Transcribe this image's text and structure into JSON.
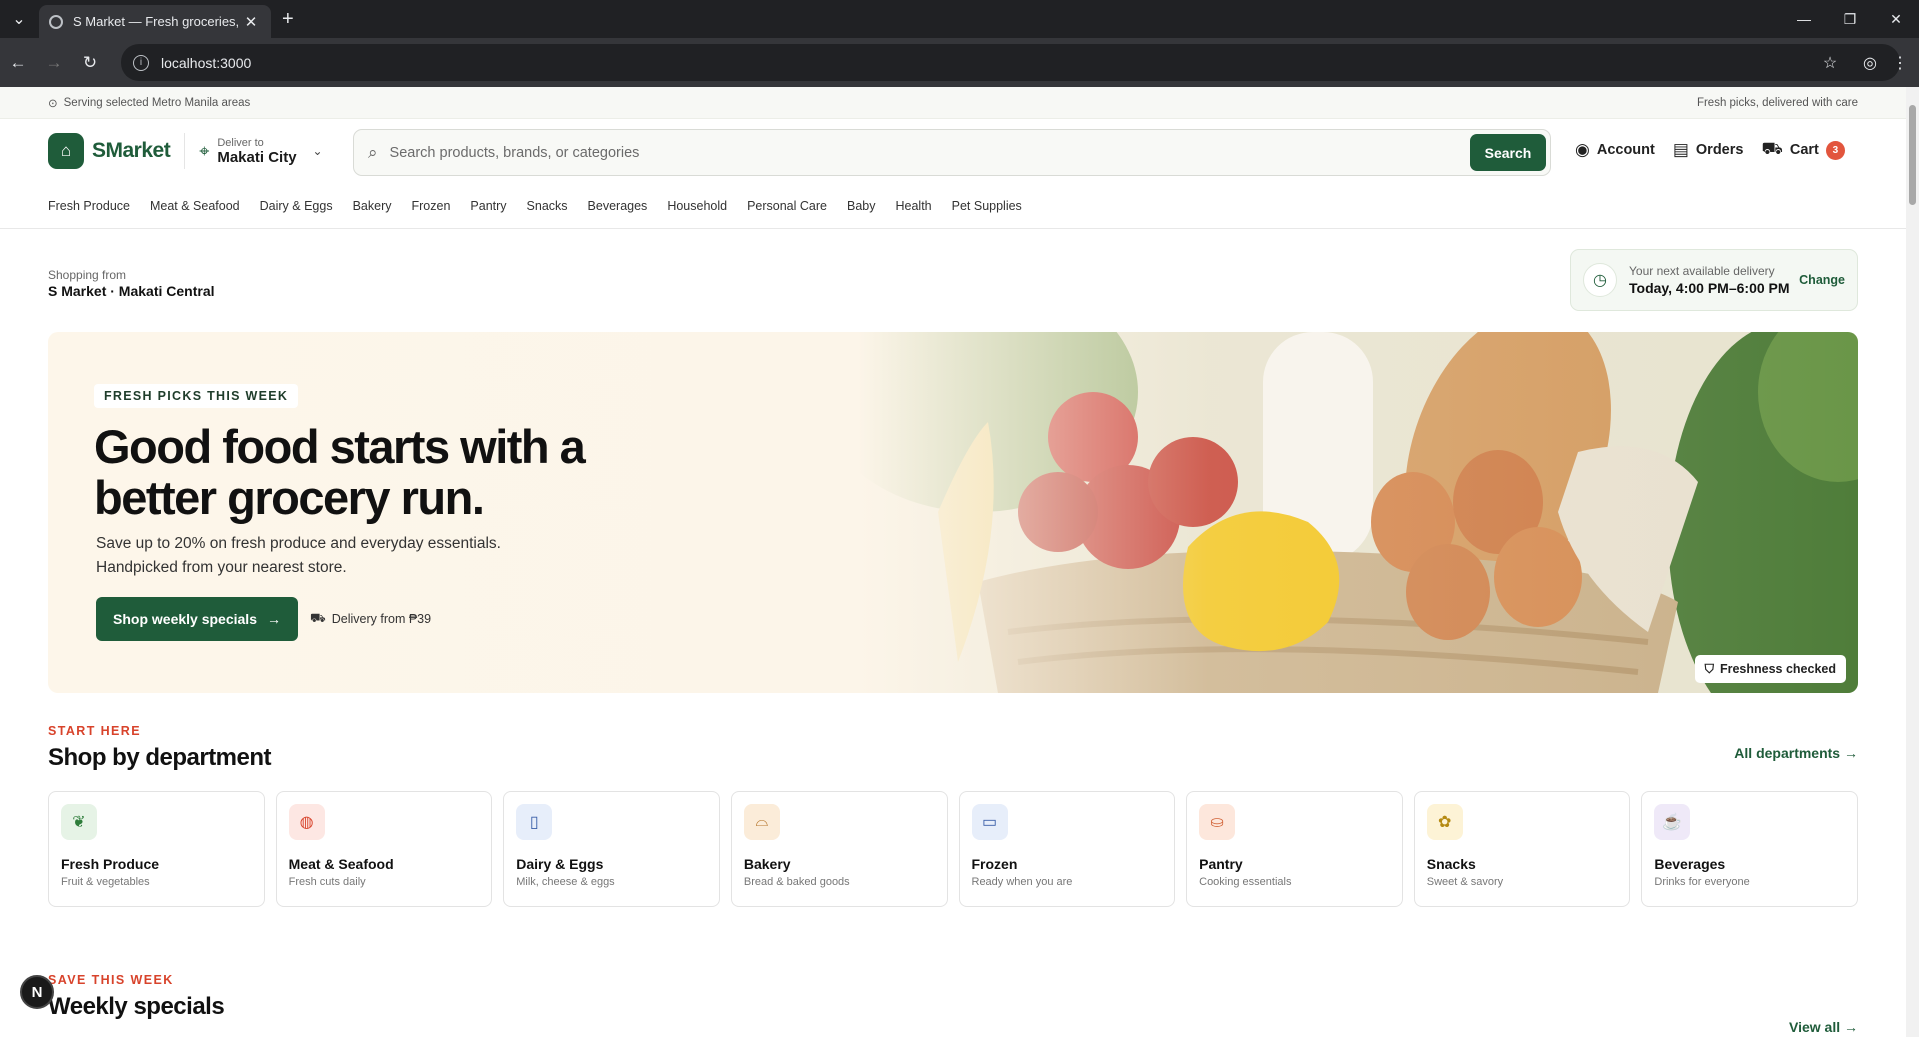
{
  "browser": {
    "tab_title": "S Market — Fresh groceries, de",
    "url": "localhost:3000"
  },
  "topstrip": {
    "left": "Serving selected Metro Manila areas",
    "right": "Fresh picks, delivered with care"
  },
  "header": {
    "brand": "SMarket",
    "deliver_label": "Deliver to",
    "deliver_city": "Makati City",
    "search_placeholder": "Search products, brands, or categories",
    "search_button": "Search",
    "account": "Account",
    "orders": "Orders",
    "cart": "Cart",
    "cart_count": "3"
  },
  "categories": [
    "Fresh Produce",
    "Meat & Seafood",
    "Dairy & Eggs",
    "Bakery",
    "Frozen",
    "Pantry",
    "Snacks",
    "Beverages",
    "Household",
    "Personal Care",
    "Baby",
    "Health",
    "Pet Supplies"
  ],
  "store": {
    "label": "Shopping from",
    "name": "S Market · Makati Central"
  },
  "delivery": {
    "label": "Your next available delivery",
    "window": "Today, 4:00 PM–6:00 PM",
    "change": "Change"
  },
  "hero": {
    "chip": "FRESH PICKS THIS WEEK",
    "title": "Good food starts with a better grocery run.",
    "subtitle": "Save up to 20% on fresh produce and everyday essentials. Handpicked from your nearest store.",
    "cta": "Shop weekly specials",
    "delivery_note": "Delivery from ₱39",
    "freshness": "Freshness checked"
  },
  "departments_section": {
    "eyebrow": "START HERE",
    "title": "Shop by department",
    "all_link": "All departments"
  },
  "departments": [
    {
      "name": "Fresh Produce",
      "desc": "Fruit & vegetables",
      "icon": "apple-icon",
      "color": "#e6f3e6",
      "fg": "#2e7d3a"
    },
    {
      "name": "Meat & Seafood",
      "desc": "Fresh cuts daily",
      "icon": "steak-icon",
      "color": "#fde7e3",
      "fg": "#d8432b"
    },
    {
      "name": "Dairy & Eggs",
      "desc": "Milk, cheese & eggs",
      "icon": "milk-icon",
      "color": "#e7eefa",
      "fg": "#3a5ea8"
    },
    {
      "name": "Bakery",
      "desc": "Bread & baked goods",
      "icon": "bread-icon",
      "color": "#fbecd9",
      "fg": "#b5752a"
    },
    {
      "name": "Frozen",
      "desc": "Ready when you are",
      "icon": "freezer-icon",
      "color": "#e7eefa",
      "fg": "#3a5ea8"
    },
    {
      "name": "Pantry",
      "desc": "Cooking essentials",
      "icon": "pot-icon",
      "color": "#fde7dc",
      "fg": "#d2653a"
    },
    {
      "name": "Snacks",
      "desc": "Sweet & savory",
      "icon": "cookie-icon",
      "color": "#fdf3d6",
      "fg": "#b58a12"
    },
    {
      "name": "Beverages",
      "desc": "Drinks for everyone",
      "icon": "cup-icon",
      "color": "#efe9f8",
      "fg": "#7a4fb0"
    }
  ],
  "specials_section": {
    "eyebrow": "SAVE THIS WEEK",
    "title": "Weekly specials",
    "view_all": "View all"
  },
  "overlay_badge": "N"
}
